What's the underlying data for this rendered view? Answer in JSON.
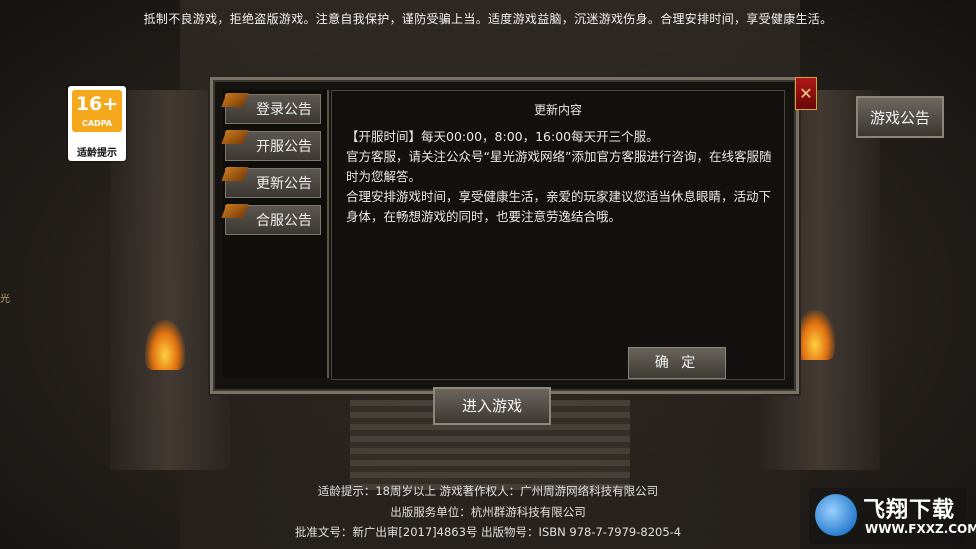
{
  "top_notice": "抵制不良游戏，拒绝盗版游戏。注意自我保护，谨防受骗上当。适度游戏益脑，沉迷游戏伤身。合理安排时间，享受健康生活。",
  "age_badge": {
    "rating": "16+",
    "org": "CADPA",
    "label": "适龄提示"
  },
  "dialog": {
    "tabs": [
      {
        "label": "登录公告"
      },
      {
        "label": "开服公告"
      },
      {
        "label": "更新公告"
      },
      {
        "label": "合服公告"
      }
    ],
    "title": "更新内容",
    "paragraphs": [
      "【开服时间】每天00:00，8:00，16:00每天开三个服。",
      "官方客服，请关注公众号“星光游戏网络”添加官方客服进行咨询，在线客服随时为您解答。",
      "合理安排游戏时间，享受健康生活，亲爱的玩家建议您适当休息眼睛，活动下身体，在畅想游戏的同时，也要注意劳逸结合哦。"
    ],
    "confirm_label": "确 定",
    "close_label": "✕"
  },
  "side_button": "游戏公告",
  "enter_button": "进入游戏",
  "side_glyph": "光",
  "footer": {
    "line1": "适龄提示：18周岁以上   游戏著作权人：广州周游网络科技有限公司",
    "line2": "出版服务单位：杭州群游科技有限公司",
    "line3": "批准文号：新广出审[2017]4863号   出版物号：ISBN 978-7-7979-8205-4"
  },
  "watermark": {
    "title": "飞翔下载",
    "url": "WWW.FXXZ.COM"
  },
  "colors": {
    "badge_orange": "#f5a81c",
    "close_red": "#b01818",
    "panel_border": "#7a7266"
  }
}
